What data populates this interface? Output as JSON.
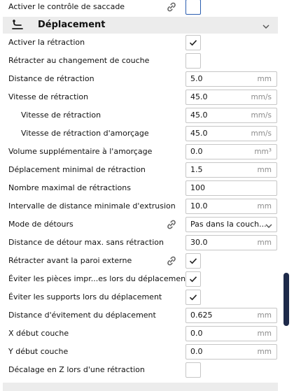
{
  "colors": {
    "accent": "#2a5db0",
    "scrollbar": "#1e2a4a",
    "category_bg": "#ececec",
    "border": "#c6c6c6",
    "unit_text": "#8b8b8b"
  },
  "icons": {
    "link": "link-icon",
    "check": "checkmark-icon",
    "travel": "travel-icon",
    "chevron": "chevron-down-icon"
  },
  "settings": {
    "top_row": {
      "label": "Activer le contrôle de saccade",
      "linked": true,
      "checked": false
    },
    "category": {
      "title": "Déplacement",
      "expanded": true
    },
    "rows": [
      {
        "label": "Activer la rétraction",
        "type": "checkbox",
        "checked": true
      },
      {
        "label": "Rétracter au changement de couche",
        "type": "checkbox",
        "checked": false
      },
      {
        "label": "Distance de rétraction",
        "type": "number",
        "value": "5.0",
        "unit": "mm"
      },
      {
        "label": "Vitesse de rétraction",
        "type": "number",
        "value": "45.0",
        "unit": "mm/s"
      },
      {
        "label": "Vitesse de rétraction",
        "type": "number",
        "value": "45.0",
        "unit": "mm/s",
        "indented": true
      },
      {
        "label": "Vitesse de rétraction d'amorçage",
        "type": "number",
        "value": "45.0",
        "unit": "mm/s",
        "indented": true
      },
      {
        "label": "Volume supplémentaire à l'amorçage",
        "type": "number",
        "value": "0.0",
        "unit": "mm³"
      },
      {
        "label": "Déplacement minimal de rétraction",
        "type": "number",
        "value": "1.5",
        "unit": "mm"
      },
      {
        "label": "Nombre maximal de rétractions",
        "type": "number",
        "value": "100",
        "unit": ""
      },
      {
        "label": "Intervalle de distance minimale d'extrusion",
        "type": "number",
        "value": "10.0",
        "unit": "mm"
      },
      {
        "label": "Mode de détours",
        "type": "select",
        "value": "Pas dans la couch...",
        "linked": true
      },
      {
        "label": "Distance de détour max. sans rétraction",
        "type": "number",
        "value": "30.0",
        "unit": "mm"
      },
      {
        "label": "Rétracter avant la paroi externe",
        "type": "checkbox",
        "checked": true,
        "linked": true
      },
      {
        "label": "Éviter les pièces impr...es lors du déplacement",
        "type": "checkbox",
        "checked": true
      },
      {
        "label": "Éviter les supports lors du déplacement",
        "type": "checkbox",
        "checked": true
      },
      {
        "label": "Distance d'évitement du déplacement",
        "type": "number",
        "value": "0.625",
        "unit": "mm"
      },
      {
        "label": "X début couche",
        "type": "number",
        "value": "0.0",
        "unit": "mm"
      },
      {
        "label": "Y début couche",
        "type": "number",
        "value": "0.0",
        "unit": "mm"
      },
      {
        "label": "Décalage en Z lors d'une rétraction",
        "type": "checkbox",
        "checked": false
      }
    ]
  }
}
